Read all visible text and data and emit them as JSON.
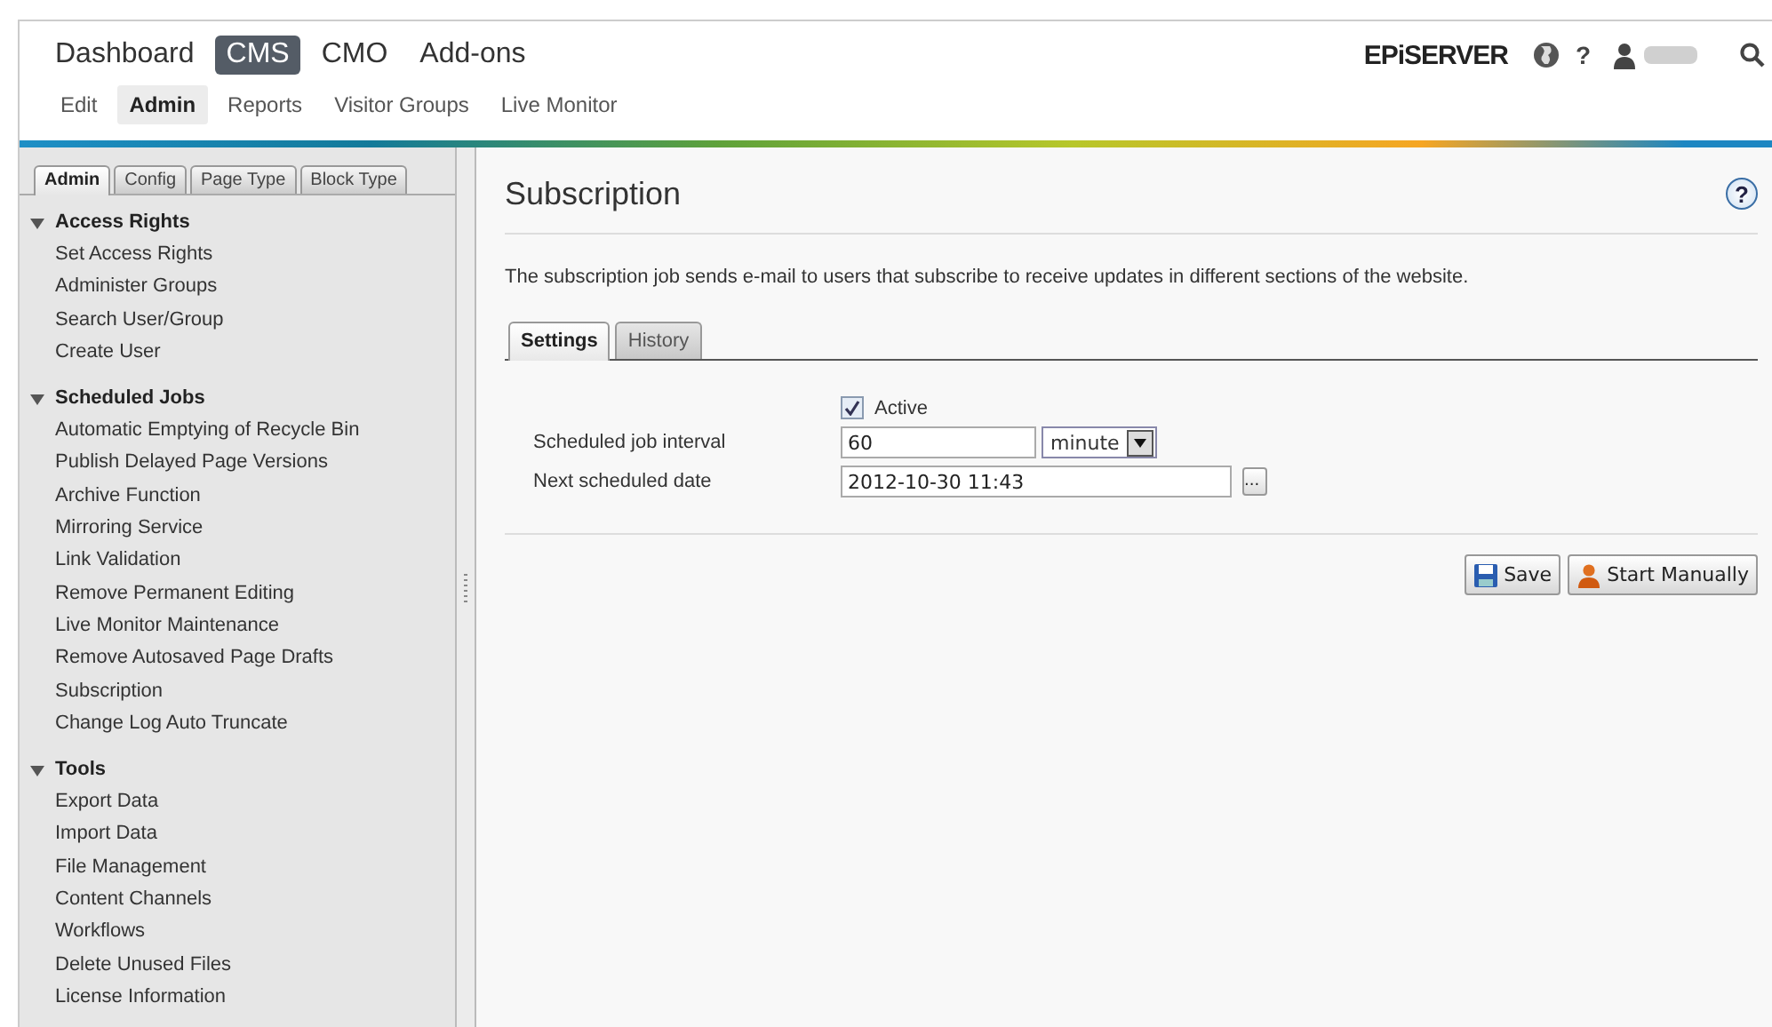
{
  "top_nav": {
    "products": [
      {
        "label": "Dashboard",
        "selected": false
      },
      {
        "label": "CMS",
        "selected": true
      },
      {
        "label": "CMO",
        "selected": false
      },
      {
        "label": "Add-ons",
        "selected": false
      }
    ],
    "sections": [
      {
        "label": "Edit",
        "selected": false
      },
      {
        "label": "Admin",
        "selected": true
      },
      {
        "label": "Reports",
        "selected": false
      },
      {
        "label": "Visitor Groups",
        "selected": false
      },
      {
        "label": "Live Monitor",
        "selected": false
      }
    ],
    "logo": "EPiSERVER",
    "help": "?"
  },
  "sidebar": {
    "tabs": [
      {
        "label": "Admin",
        "selected": true
      },
      {
        "label": "Config",
        "selected": false
      },
      {
        "label": "Page Type",
        "selected": false
      },
      {
        "label": "Block Type",
        "selected": false
      }
    ],
    "groups": [
      {
        "title": "Access Rights",
        "expanded": true,
        "items": [
          "Set Access Rights",
          "Administer Groups",
          "Search User/Group",
          "Create User"
        ]
      },
      {
        "title": "Scheduled Jobs",
        "expanded": true,
        "items": [
          "Automatic Emptying of Recycle Bin",
          "Publish Delayed Page Versions",
          "Archive Function",
          "Mirroring Service",
          "Link Validation",
          "Remove Permanent Editing",
          "Live Monitor Maintenance",
          "Remove Autosaved Page Drafts",
          "Subscription",
          "Change Log Auto Truncate"
        ]
      },
      {
        "title": "Tools",
        "expanded": true,
        "items": [
          "Export Data",
          "Import Data",
          "File Management",
          "Content Channels",
          "Workflows",
          "Delete Unused Files",
          "License Information"
        ]
      }
    ]
  },
  "page": {
    "title": "Subscription",
    "help": "?",
    "description": "The subscription job sends e-mail to users that subscribe to receive updates in different sections of the website.",
    "tabs": [
      {
        "label": "Settings",
        "selected": true
      },
      {
        "label": "History",
        "selected": false
      }
    ],
    "active": {
      "label": "Active",
      "checked": true
    },
    "fields": [
      {
        "kind": "interval",
        "label": "Scheduled job interval",
        "value": "60",
        "unit": "minute"
      },
      {
        "kind": "date",
        "label": "Next scheduled date",
        "value": "2012-10-30 11:43",
        "picker": "..."
      }
    ],
    "buttons": [
      {
        "kind": "save",
        "label": "Save"
      },
      {
        "kind": "run",
        "label": "Start Manually"
      }
    ]
  }
}
